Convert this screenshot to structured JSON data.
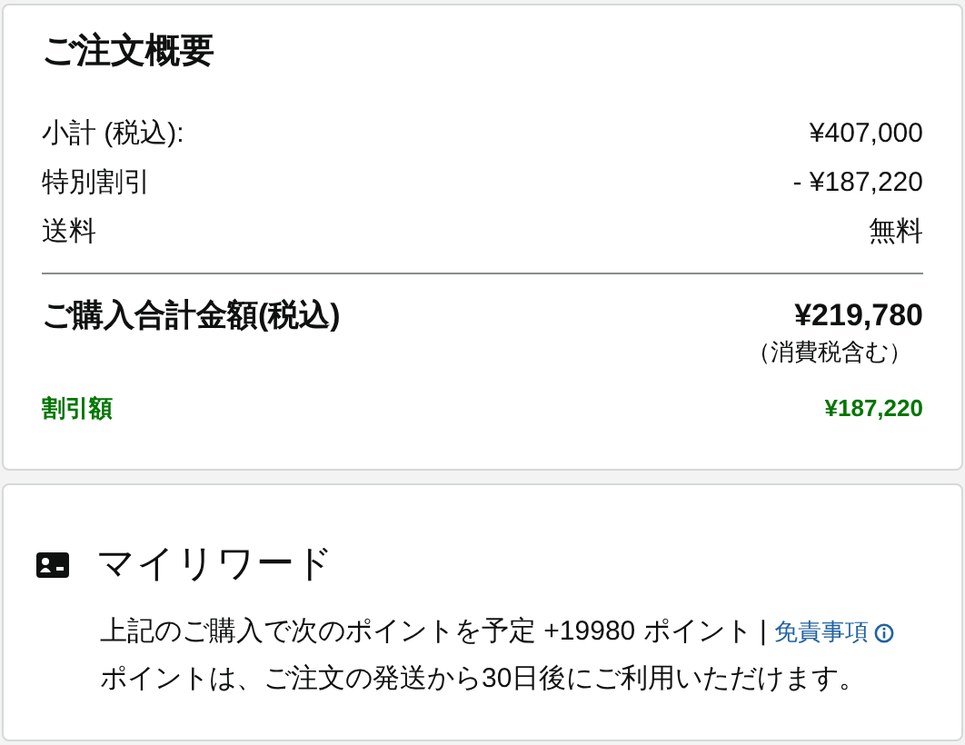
{
  "summary": {
    "title": "ご注文概要",
    "rows": [
      {
        "label": "小計 (税込):",
        "value": "¥407,000"
      },
      {
        "label": "特別割引",
        "value": "- ¥187,220"
      },
      {
        "label": "送料",
        "value": "無料"
      }
    ],
    "total": {
      "label": "ご購入合計金額(税込)",
      "value": "¥219,780",
      "note": "（消費税含む）"
    },
    "discount": {
      "label": "割引額",
      "value": "¥187,220"
    }
  },
  "rewards": {
    "title": "マイリワード",
    "points_text": "上記のご購入で次のポイントを予定 +19980 ポイント |",
    "disclaimer_link": "免責事項",
    "note": "ポイントは、ご注文の発送から30日後にご利用いただけます。"
  }
}
